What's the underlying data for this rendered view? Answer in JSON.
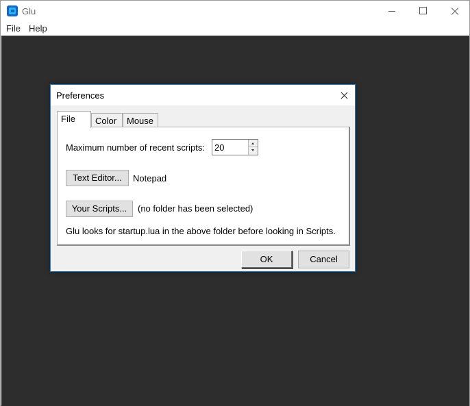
{
  "window": {
    "title": "Glu",
    "icon": "glu-app-icon",
    "controls": {
      "minimize_icon": "minimize-icon",
      "maximize_icon": "maximize-icon",
      "close_icon": "close-icon"
    }
  },
  "menubar": {
    "items": [
      "File",
      "Help"
    ]
  },
  "dialog": {
    "title": "Preferences",
    "close_icon": "close-icon",
    "tabs": [
      {
        "label": "File",
        "active": true
      },
      {
        "label": "Color",
        "active": false
      },
      {
        "label": "Mouse",
        "active": false
      }
    ],
    "file_tab": {
      "recent_label": "Maximum number of recent scripts:",
      "recent_value": "20",
      "text_editor_button": "Text Editor...",
      "text_editor_value": "Notepad",
      "your_scripts_button": "Your Scripts...",
      "scripts_folder_value": "(no folder has been selected)",
      "startup_note": "Glu looks for startup.lua in the above folder before looking in Scripts."
    },
    "buttons": {
      "ok": "OK",
      "cancel": "Cancel"
    }
  },
  "colors": {
    "canvas": "#2d2d2d",
    "dialog_border": "#1883d7",
    "dialog_bg": "#f0f0f0"
  }
}
